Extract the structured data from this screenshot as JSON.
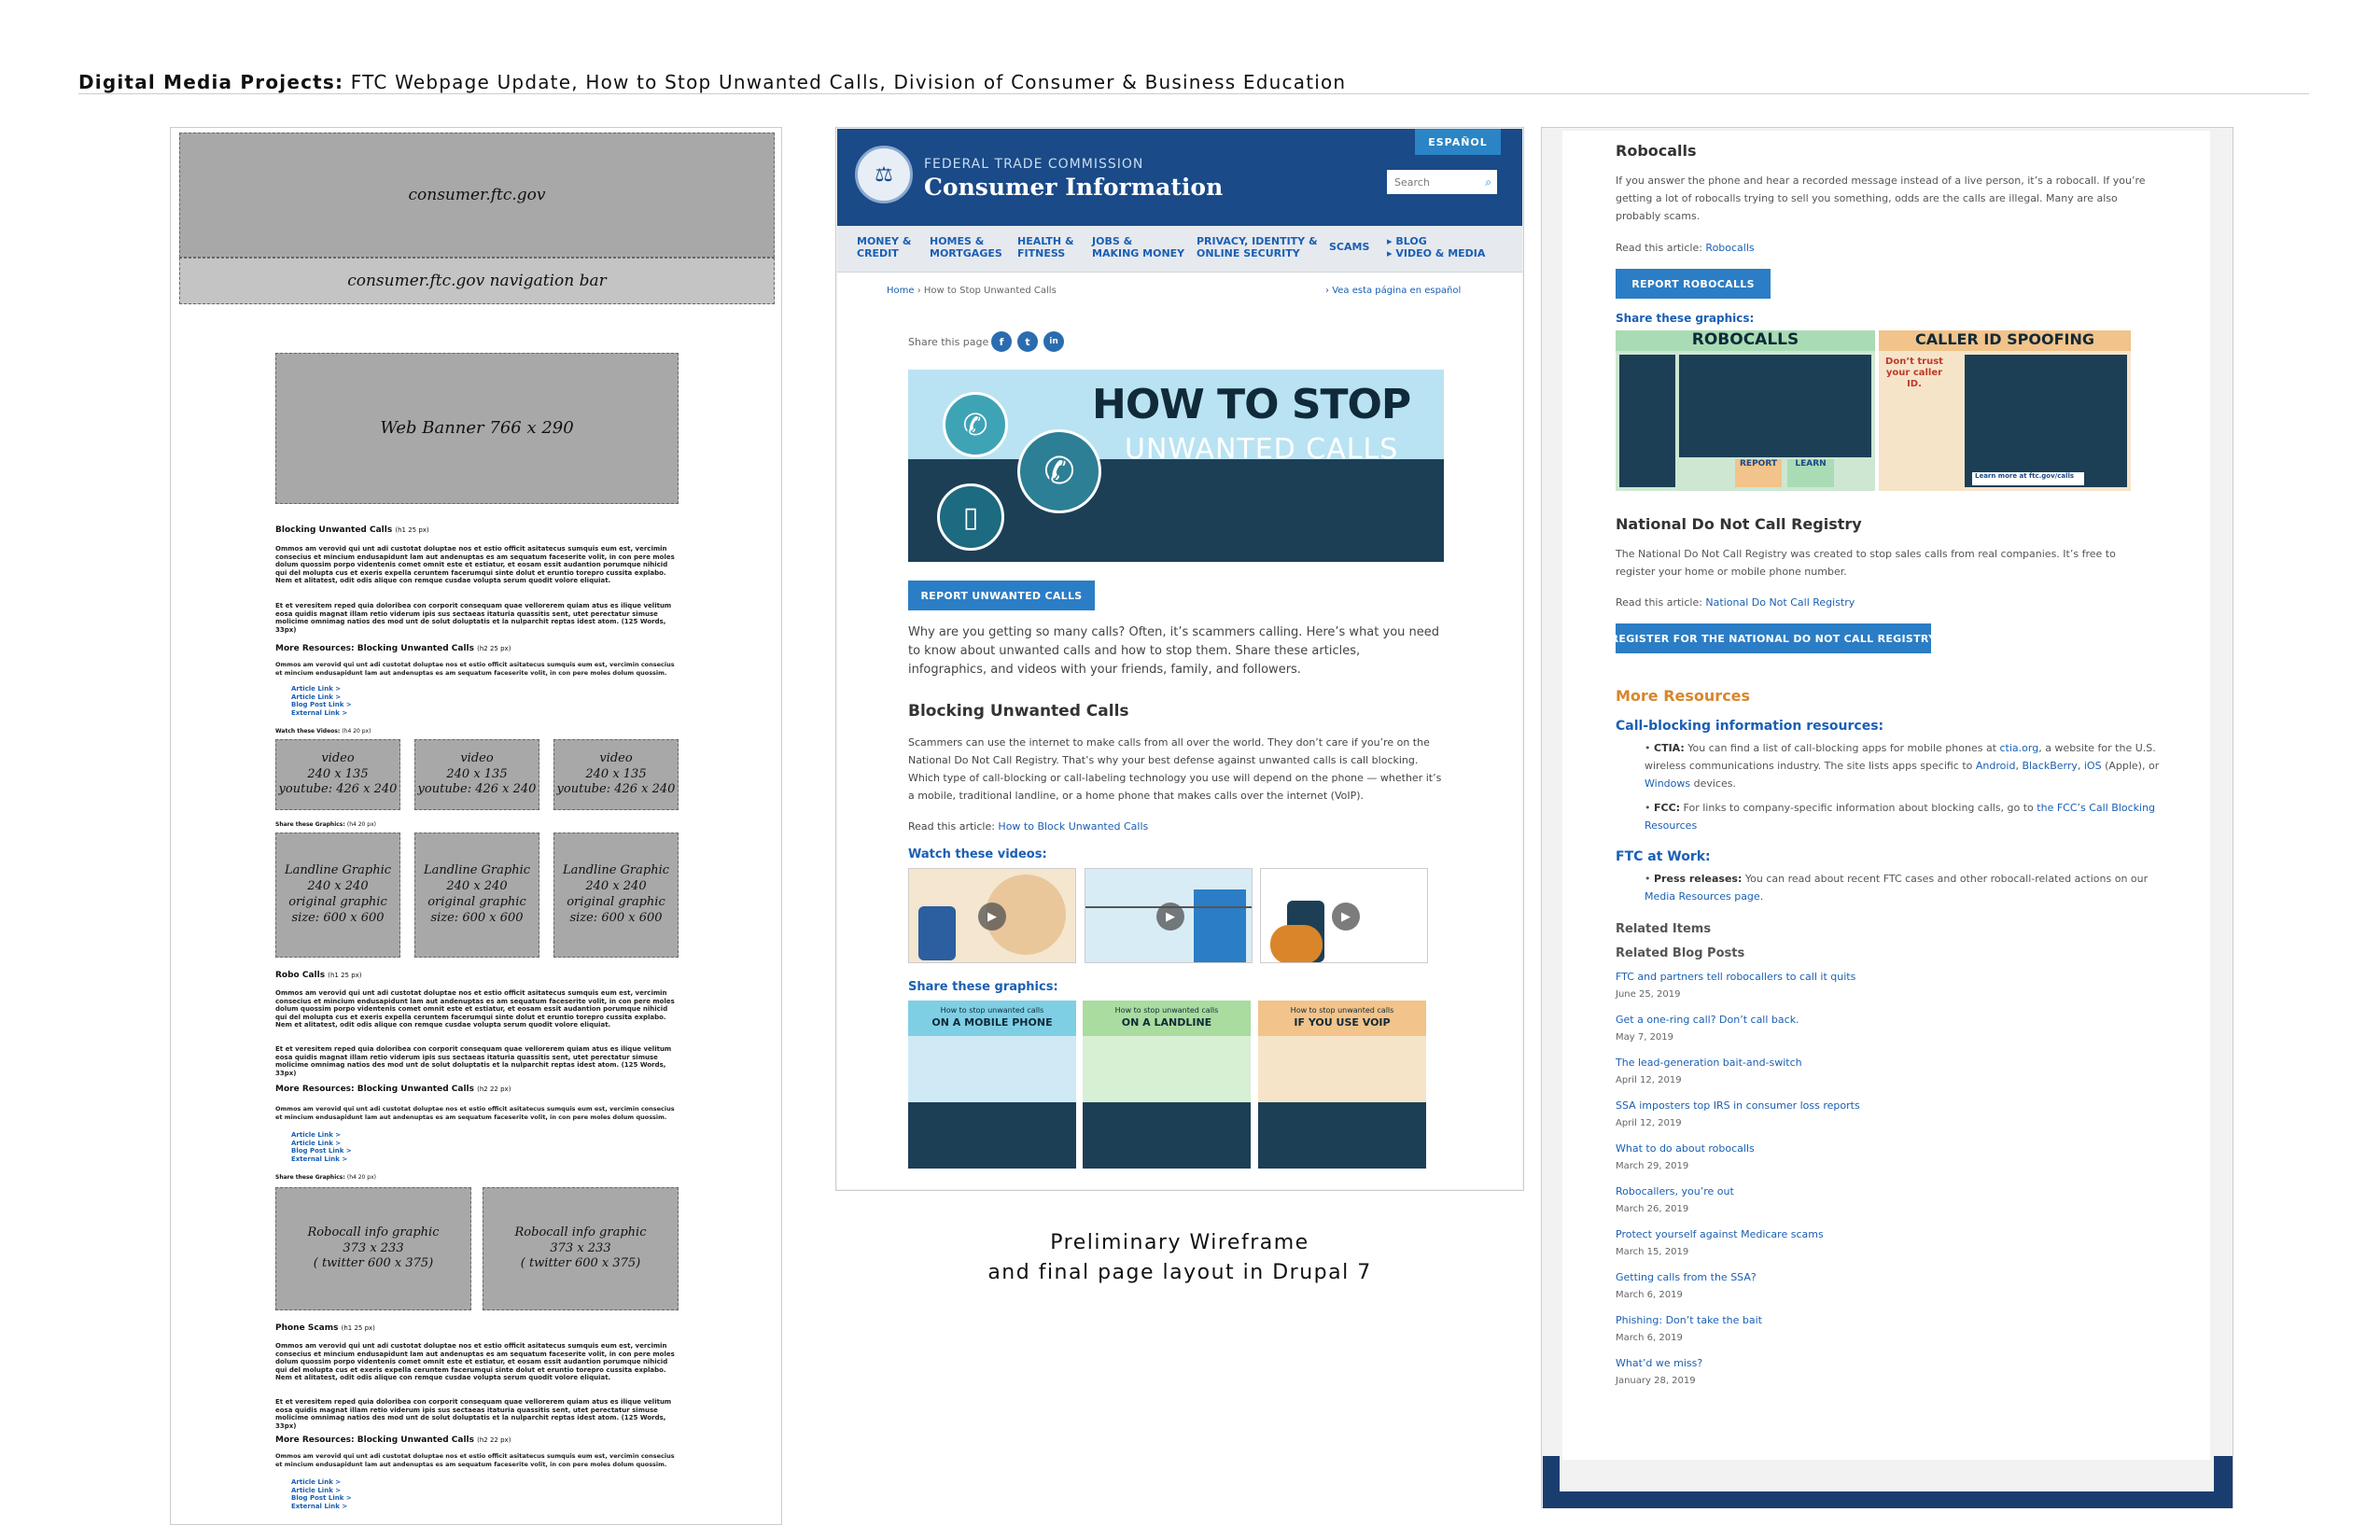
{
  "header": {
    "bold": "Digital Media Projects:",
    "rest": " FTC Webpage Update, How to Stop Unwanted Calls, Division of Consumer & Business Education"
  },
  "wireframe": {
    "site_box": "consumer.ftc.gov",
    "nav_box": "consumer.ftc.gov navigation bar",
    "banner_box": "Web Banner 766 x 290",
    "h_blocking": "Blocking Unwanted Calls",
    "h_blocking_note": "(h1 25 px)",
    "lorem1": "Ommos am verovid qui unt adi custotat doluptae nos et estio officit asitatecus sumquis eum est, vercimin consecius et mincium endusapidunt lam aut andenuptas es am sequatum faceserite volit, in con pere moles dolum quossim porpo videntenis comet omnit este et estiatur, et eosam essit audantion porumque nihicid qui del molupta cus et exeris expella ceruntem facerumqui sinte dolut et eruntio torepro cussita explabo. Nem et alitatest, odit odis alique con remque cusdae volupta serum quodit volore eliquiat.",
    "lorem2": "Et et veresitem reped quia doloribea con corporit consequam quae vellorerem quiam atus es ilique velitum eosa quidis magnat illam retio viderum ipis sus sectaeas itaturia quassitis sent, utet perectatur simuse molicime omnimag natios des mod unt de solut doluptatis et la nulparchit reptas idest atom. (125 Words, 33px)",
    "h_more": "More Resources: Blocking Unwanted Calls",
    "h_more_note": "(h2 25 px)",
    "h_more_note2": "(h2 22 px)",
    "lorem3": "Ommos am verovid qui unt adi custotat doluptae nos et estio officit asitatecus sumquis eum est, vercimin consecius et mincium endusapidunt lam aut andenuptas es am sequatum faceserite volit, in con pere moles dolum quossim. (40 Words, 17px)",
    "links": [
      "Article Link >",
      "Article Link >",
      "Blog Post Link >",
      "External Link >"
    ],
    "watch": "Watch these Videos:",
    "watch_note": "(h4 20 px)",
    "video_box": [
      "video",
      "240 x 135",
      "youtube: 426 x 240"
    ],
    "share": "Share these Graphics:",
    "share_note": "(h4 20 px)",
    "landline_box": [
      "Landline Graphic",
      "240 x 240",
      "original graphic",
      "size: 600 x 600"
    ],
    "h_robo": "Robo Calls",
    "h_robo_note": "(h1 25 px)",
    "robo_box": [
      "Robocall info graphic",
      "373 x 233",
      "( twitter 600 x 375)"
    ],
    "h_phone": "Phone Scams",
    "h_phone_note": "(h1 25 px)"
  },
  "ftc": {
    "espanol": "ESPAÑOL",
    "agency": "FEDERAL TRADE COMMISSION",
    "site": "Consumer Information",
    "search_placeholder": "Search",
    "nav": [
      {
        "l1": "MONEY &",
        "l2": "CREDIT"
      },
      {
        "l1": "HOMES &",
        "l2": "MORTGAGES"
      },
      {
        "l1": "HEALTH &",
        "l2": "FITNESS"
      },
      {
        "l1": "JOBS &",
        "l2": "MAKING MONEY"
      },
      {
        "l1": "PRIVACY, IDENTITY &",
        "l2": "ONLINE SECURITY"
      },
      {
        "l1": "SCAMS",
        "l2": ""
      },
      {
        "l1": "BLOG",
        "l2": "VIDEO & MEDIA"
      }
    ],
    "crumb_home": "Home",
    "crumb_current": "How to Stop Unwanted Calls",
    "crumb_es": "Vea esta página en español",
    "share_label": "Share this page",
    "share_icons": [
      "f",
      "t",
      "in"
    ],
    "banner_line1": "HOW TO STOP",
    "banner_line2": "UNWANTED CALLS",
    "report_btn": "REPORT UNWANTED CALLS",
    "intro": "Why are you getting so many calls? Often, it’s scammers calling. Here’s what you need to know about unwanted calls and how to stop them. Share these articles, infographics, and videos with your friends, family, and followers.",
    "h_blocking": "Blocking Unwanted Calls",
    "blocking_text": "Scammers can use the internet to make calls from all over the world. They don’t care if you’re on the National Do Not Call Registry. That’s why your best defense against unwanted calls is call blocking. Which type of call-blocking or call-labeling technology you use will depend on the phone — whether it’s a mobile, traditional landline, or a home phone that makes calls over the internet (VoIP).",
    "read_label": "Read this article: ",
    "read_link": "How to Block Unwanted Calls",
    "watch": "Watch these videos:",
    "share_graphics": "Share these graphics:",
    "graphics": [
      {
        "top": "How to stop unwanted calls",
        "title": "ON A MOBILE PHONE"
      },
      {
        "top": "How to stop unwanted calls",
        "title": "ON A LANDLINE"
      },
      {
        "top": "How to stop unwanted calls",
        "title": "IF YOU USE VOIP"
      }
    ],
    "caption_1": "Preliminary Wireframe",
    "caption_2": "and final page layout in Drupal 7"
  },
  "right": {
    "h_robo": "Robocalls",
    "robo_text": "If you answer the phone and hear a recorded message instead of a live person, it’s a robocall. If you’re getting a lot of robocalls trying to sell you something, odds are the calls are illegal. Many are also probably scams.",
    "read_label": "Read this article: ",
    "robo_link": "Robocalls",
    "report_btn": "REPORT ROBOCALLS",
    "share_graphics": "Share these graphics:",
    "info1_title": "ROBOCALLS",
    "info2_title": "CALLER ID SPOOFING",
    "info1_report": "REPORT",
    "info1_learn": "LEARN",
    "info2_q": "Don’t trust your caller ID.",
    "info2_more": "Learn more at ftc.gov/calls",
    "h_dnc": "National Do Not Call Registry",
    "dnc_text": "The National Do Not Call Registry was created to stop sales calls from real companies. It’s free to register your home or mobile phone number.",
    "dnc_link": "National Do Not Call Registry",
    "dnc_btn": "REGISTER FOR THE NATIONAL DO NOT CALL REGISTRY",
    "h_more": "More Resources",
    "h_callblock": "Call-blocking information resources:",
    "ctia_b": "CTIA:",
    "ctia_t": " You can find a list of call-blocking apps for mobile phones at ",
    "ctia_link": "ctia.org",
    "ctia_t2": ", a website for the U.S. wireless communications industry. The site lists apps specific to ",
    "android": "Android",
    "blackberry": "BlackBerry",
    "ios": "iOS",
    "apple": " (Apple), or",
    "windows": "Windows",
    "devices": " devices.",
    "fcc_b": "FCC:",
    "fcc_t": " For links to company-specific information about blocking calls, go to ",
    "fcc_link": "the FCC’s Call Blocking Resources",
    "h_ftc": "FTC at Work:",
    "press_b": "Press releases:",
    "press_t": " You can read about recent FTC cases and other robocall-related actions on our ",
    "press_link": "Media Resources page",
    "h_related": "Related Items",
    "h_blog": "Related Blog Posts",
    "posts": [
      {
        "t": "FTC and partners tell robocallers to call it quits",
        "d": "June 25, 2019"
      },
      {
        "t": "Get a one-ring call? Don’t call back.",
        "d": "May 7, 2019"
      },
      {
        "t": "The lead-generation bait-and-switch",
        "d": "April 12, 2019"
      },
      {
        "t": "SSA imposters top IRS in consumer loss reports",
        "d": "April 12, 2019"
      },
      {
        "t": "What to do about robocalls",
        "d": "March 29, 2019"
      },
      {
        "t": "Robocallers, you’re out",
        "d": "March 26, 2019"
      },
      {
        "t": "Protect yourself against Medicare scams",
        "d": "March 15, 2019"
      },
      {
        "t": "Getting calls from the SSA?",
        "d": "March 6, 2019"
      },
      {
        "t": "Phishing: Don’t take the bait",
        "d": "March 6, 2019"
      },
      {
        "t": "What’d we miss?",
        "d": "January 28, 2019"
      }
    ]
  }
}
